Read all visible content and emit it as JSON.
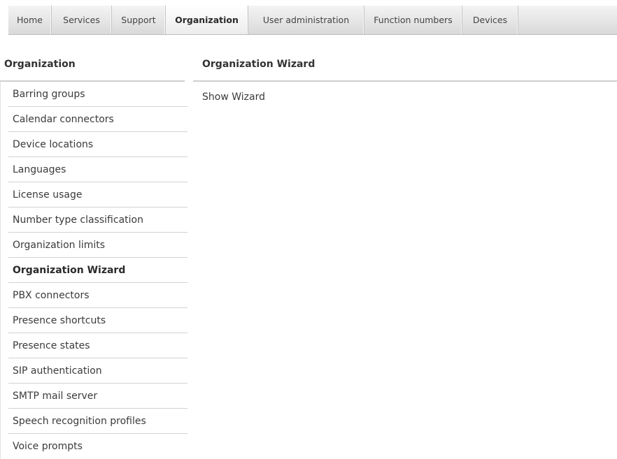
{
  "tabs": [
    {
      "label": "Home"
    },
    {
      "label": "Services"
    },
    {
      "label": "Support"
    },
    {
      "label": "Organization",
      "active": true
    },
    {
      "label": "User administration"
    },
    {
      "label": "Function numbers"
    },
    {
      "label": "Devices"
    }
  ],
  "sidebar": {
    "title": "Organization",
    "items": [
      {
        "label": "Barring groups"
      },
      {
        "label": "Calendar connectors"
      },
      {
        "label": "Device locations"
      },
      {
        "label": "Languages"
      },
      {
        "label": "License usage"
      },
      {
        "label": "Number type classification"
      },
      {
        "label": "Organization limits"
      },
      {
        "label": "Organization Wizard",
        "active": true
      },
      {
        "label": "PBX connectors"
      },
      {
        "label": "Presence shortcuts"
      },
      {
        "label": "Presence states"
      },
      {
        "label": "SIP authentication"
      },
      {
        "label": "SMTP mail server"
      },
      {
        "label": "Speech recognition profiles"
      },
      {
        "label": "Voice prompts"
      }
    ]
  },
  "main": {
    "title": "Organization Wizard",
    "link_label": "Show Wizard"
  },
  "colors": {
    "text": "#333333",
    "rule": "#cfcfcf",
    "tab_bar_top": "#f4f4f4",
    "tab_bar_bottom": "#d9d9d9"
  }
}
